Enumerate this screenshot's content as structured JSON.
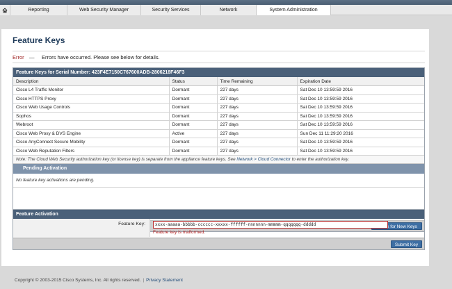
{
  "nav": {
    "tabs": [
      "Reporting",
      "Web Security Manager",
      "Security Services",
      "Network",
      "System Administration"
    ],
    "active_tab": "System Administration"
  },
  "page": {
    "title": "Feature Keys"
  },
  "alert": {
    "label": "Error",
    "separator": "—",
    "message": "Errors have occurred. Please see below for details."
  },
  "feature_keys": {
    "heading": "Feature Keys for Serial Number: 423F4E7150C767600ADB-2806218F46F3",
    "columns": [
      "Description",
      "Status",
      "Time Remaining",
      "Expiration Date"
    ],
    "rows": [
      [
        "Cisco L4 Traffic Monitor",
        "Dormant",
        "227 days",
        "Sat Dec 10 13:59:59 2016"
      ],
      [
        "Cisco HTTPS Proxy",
        "Dormant",
        "227 days",
        "Sat Dec 10 13:59:59 2016"
      ],
      [
        "Cisco Web Usage Controls",
        "Dormant",
        "227 days",
        "Sat Dec 10 13:59:59 2016"
      ],
      [
        "Sophos",
        "Dormant",
        "227 days",
        "Sat Dec 10 13:59:59 2016"
      ],
      [
        "Webroot",
        "Dormant",
        "227 days",
        "Sat Dec 10 13:59:59 2016"
      ],
      [
        "Cisco Web Proxy & DVS Engine",
        "Active",
        "227 days",
        "Sun Dec 11 11:29:20 2016"
      ],
      [
        "Cisco AnyConnect Secure Mobility",
        "Dormant",
        "227 days",
        "Sat Dec 10 13:59:59 2016"
      ],
      [
        "Cisco Web Reputation Filters",
        "Dormant",
        "227 days",
        "Sat Dec 10 13:59:59 2016"
      ]
    ],
    "note_prefix": "Note: The Cloud Web Security authorization key (or license key) is separate from the appliance feature keys. See ",
    "note_link": "Network > Cloud Connector",
    "note_suffix": " to enter the authorization key.",
    "pending_heading": "Pending Activation",
    "pending_message": "No feature key activations are pending.",
    "check_button": "Check for New Keys"
  },
  "activation": {
    "heading": "Feature Activation",
    "field_label": "Feature Key:",
    "field_value": "xxxx-aaaaa-bbbbb-cccccc-xxxxx-ffffff-nnnnnnn-mmmmm-qqqqqqq-ddddd",
    "error": "Feature key is malformed.",
    "submit_button": "Submit Key"
  },
  "footer": {
    "copyright": "Copyright © 2003-2015 Cisco Systems, Inc. All rights reserved.",
    "separator": "|",
    "privacy_link": "Privacy Statement"
  },
  "colors": {
    "header_bar": "#4a6079",
    "sub_header": "#7f93ab",
    "button": "#3d6ea3",
    "error": "#9b1c1c"
  },
  "icons": {
    "home": "home-icon"
  }
}
